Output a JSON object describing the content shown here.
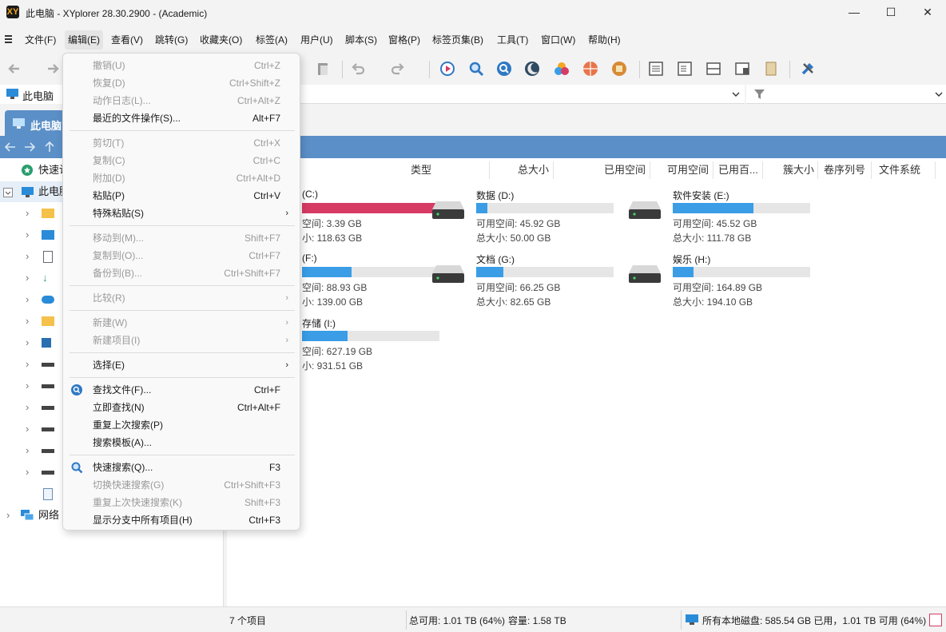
{
  "window": {
    "title": "此电脑 - XYplorer 28.30.2900 - (Academic)",
    "logo": "XY",
    "minimize": "—",
    "maximize": "☐",
    "close": "✕"
  },
  "menubar": {
    "items": [
      "文件(F)",
      "编辑(E)",
      "查看(V)",
      "跳转(G)",
      "收藏夹(O)",
      "标签(A)",
      "用户(U)",
      "脚本(S)",
      "窗格(P)",
      "标签页集(B)",
      "工具(T)",
      "窗口(W)",
      "帮助(H)"
    ],
    "active": "编辑(E)"
  },
  "address": {
    "location": "此电脑"
  },
  "tab": {
    "label": "此电脑"
  },
  "tree": {
    "quick_access": "快速访",
    "this_pc": "此电脑",
    "network": "网络"
  },
  "columns": {
    "type": "类型",
    "total_size": "总大小",
    "used_space": "已用空间",
    "free_space": "可用空间",
    "used_pct": "已用百...",
    "cluster_size": "簇大小",
    "volume_serial": "卷序列号",
    "file_system": "文件系统"
  },
  "drives": [
    {
      "name": "(C:)",
      "free": "空间: 3.39 GB",
      "total": "小: 118.63 GB",
      "used_fraction": 0.97,
      "bar_color": "#d63b63"
    },
    {
      "name": "数据 (D:)",
      "free": "可用空间: 45.92 GB",
      "total": "总大小: 50.00 GB",
      "used_fraction": 0.08,
      "bar_color": "#3a9de6"
    },
    {
      "name": "软件安装 (E:)",
      "free": "可用空间: 45.52 GB",
      "total": "总大小: 111.78 GB",
      "used_fraction": 0.59,
      "bar_color": "#3a9de6"
    },
    {
      "name": "(F:)",
      "free": "空间: 88.93 GB",
      "total": "小: 139.00 GB",
      "used_fraction": 0.36,
      "bar_color": "#3a9de6"
    },
    {
      "name": "文档 (G:)",
      "free": "可用空间: 66.25 GB",
      "total": "总大小: 82.65 GB",
      "used_fraction": 0.2,
      "bar_color": "#3a9de6"
    },
    {
      "name": "娱乐 (H:)",
      "free": "可用空间: 164.89 GB",
      "total": "总大小: 194.10 GB",
      "used_fraction": 0.15,
      "bar_color": "#3a9de6"
    },
    {
      "name": "存储 (I:)",
      "free": "空间: 627.19 GB",
      "total": "小: 931.51 GB",
      "used_fraction": 0.33,
      "bar_color": "#3a9de6"
    }
  ],
  "statusbar": {
    "items": "7 个项目",
    "total_free": "总可用: 1.01 TB (64%)",
    "capacity": "容量: 1.58 TB",
    "all_disks": "所有本地磁盘: 585.54 GB 已用，1.01 TB 可用 (64%)"
  },
  "edit_menu": {
    "undo": {
      "label": "撤销(U)",
      "shortcut": "Ctrl+Z"
    },
    "redo": {
      "label": "恢复(D)",
      "shortcut": "Ctrl+Shift+Z"
    },
    "action_log": {
      "label": "动作日志(L)...",
      "shortcut": "Ctrl+Alt+Z"
    },
    "recent_ops": {
      "label": "最近的文件操作(S)...",
      "shortcut": "Alt+F7"
    },
    "cut": {
      "label": "剪切(T)",
      "shortcut": "Ctrl+X"
    },
    "copy": {
      "label": "复制(C)",
      "shortcut": "Ctrl+C"
    },
    "append": {
      "label": "附加(D)",
      "shortcut": "Ctrl+Alt+D"
    },
    "paste": {
      "label": "粘贴(P)",
      "shortcut": "Ctrl+V"
    },
    "paste_special": {
      "label": "特殊粘贴(S)"
    },
    "move_to": {
      "label": "移动到(M)...",
      "shortcut": "Shift+F7"
    },
    "copy_to": {
      "label": "复制到(O)...",
      "shortcut": "Ctrl+F7"
    },
    "backup_to": {
      "label": "备份到(B)...",
      "shortcut": "Ctrl+Shift+F7"
    },
    "compare": {
      "label": "比较(R)"
    },
    "new": {
      "label": "新建(W)"
    },
    "new_items": {
      "label": "新建项目(I)"
    },
    "select": {
      "label": "选择(E)"
    },
    "find_files": {
      "label": "查找文件(F)...",
      "shortcut": "Ctrl+F"
    },
    "instant_find": {
      "label": "立即查找(N)",
      "shortcut": "Ctrl+Alt+F"
    },
    "repeat_search": {
      "label": "重复上次搜索(P)"
    },
    "search_templates": {
      "label": "搜索模板(A)..."
    },
    "quick_search": {
      "label": "快速搜索(Q)...",
      "shortcut": "F3"
    },
    "toggle_quick": {
      "label": "切换快速搜索(G)",
      "shortcut": "Ctrl+Shift+F3"
    },
    "repeat_quick": {
      "label": "重复上次快速搜索(K)",
      "shortcut": "Shift+F3"
    },
    "show_all_branch": {
      "label": "显示分支中所有项目(H)",
      "shortcut": "Ctrl+F3"
    }
  }
}
